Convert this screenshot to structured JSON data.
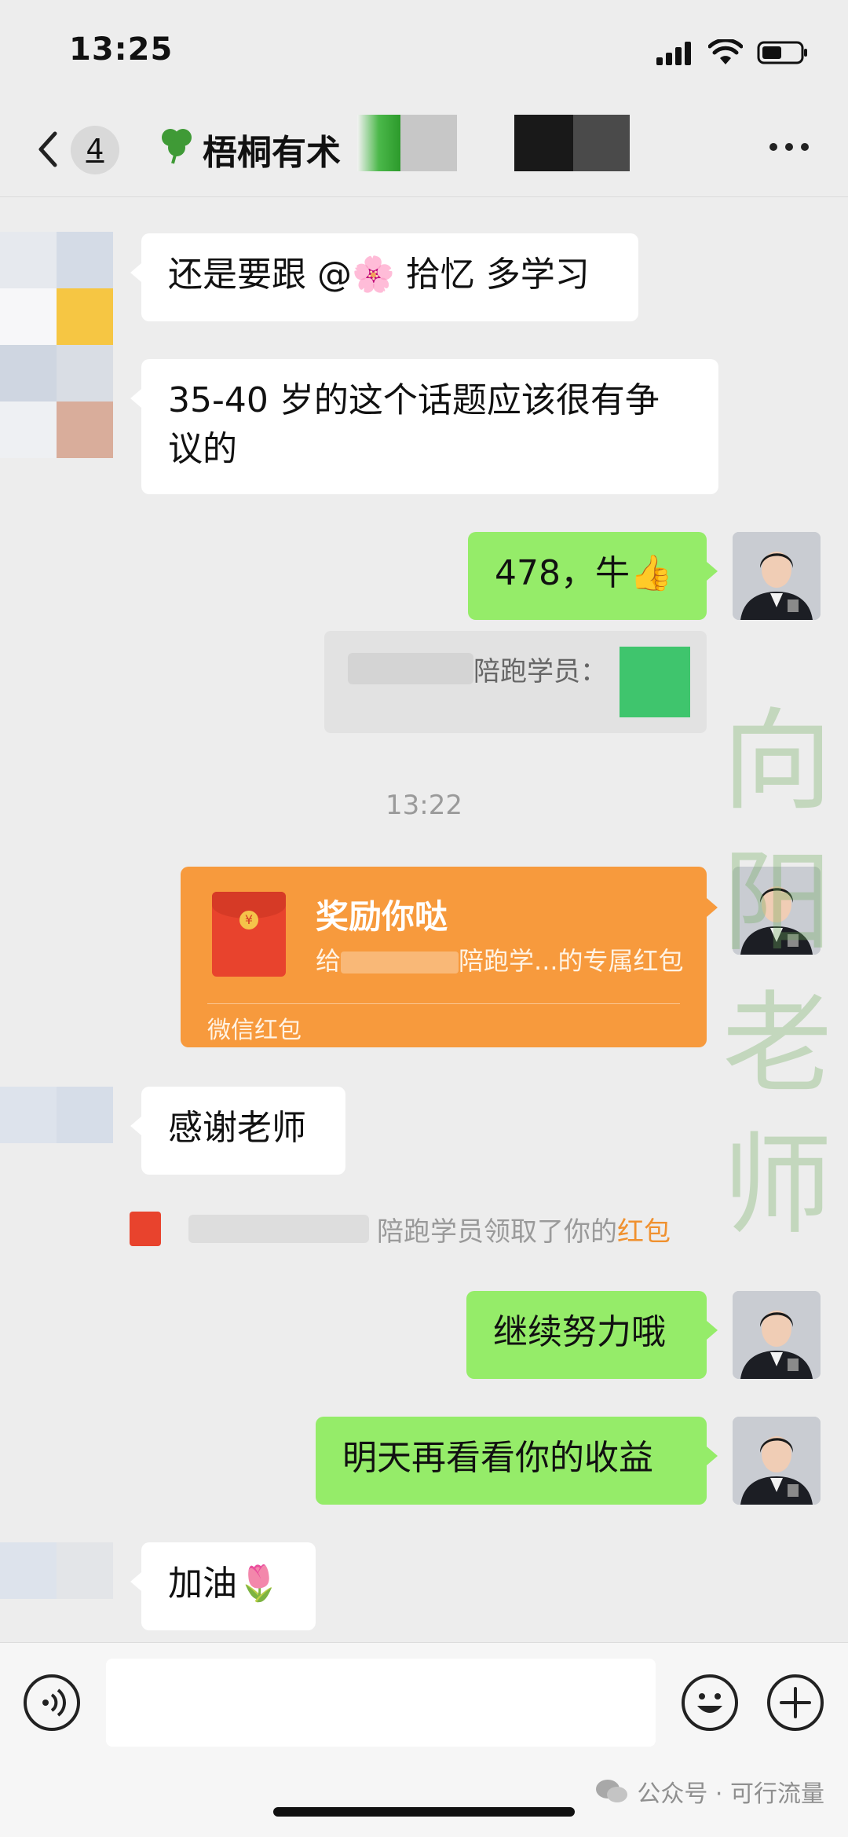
{
  "status_bar": {
    "time": "13:25"
  },
  "header": {
    "back_label": "<",
    "unread_count": "4",
    "chat_title": "梧桐有术"
  },
  "messages": [
    {
      "side": "left",
      "text": "还是要跟 @🌸 拾忆 多学习"
    },
    {
      "side": "left",
      "text": "35-40 岁的这个话题应该很有争议的"
    },
    {
      "side": "right",
      "text": "478，牛👍"
    },
    {
      "quote_text": "陪跑学员："
    },
    {
      "timestamp": "13:22"
    },
    {
      "red_packet_title": "奖励你哒",
      "red_packet_prefix": "给",
      "red_packet_suffix": "陪跑学...的专属红包",
      "red_packet_footer": "微信红包"
    },
    {
      "side": "left",
      "text": "感谢老师"
    },
    {
      "system_text": "陪跑学员领取了你的",
      "system_link": "红包"
    },
    {
      "side": "right",
      "text": "继续努力哦"
    },
    {
      "side": "right",
      "text": "明天再看看你的收益"
    },
    {
      "side": "left",
      "text": "加油🌷"
    }
  ],
  "watermark": "向\n阳\n老\n师",
  "footer_credit": "公众号 · 可行流量",
  "input": {
    "placeholder": ""
  },
  "colors": {
    "background": "#ededed",
    "bubble_right": "#95ec69",
    "bubble_left": "#ffffff",
    "red_packet": "#f79a3d",
    "link_orange": "#f0912f"
  },
  "icons": [
    "back-icon",
    "more-icon",
    "red-packet-icon",
    "voice-icon",
    "emoji-icon",
    "plus-icon",
    "wechat-logo-icon"
  ]
}
